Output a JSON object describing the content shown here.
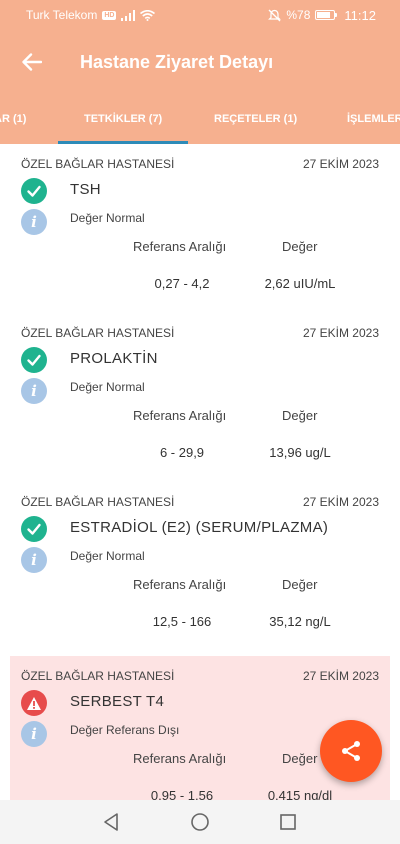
{
  "status_bar": {
    "carrier": "Turk Telekom",
    "carrier_badge": "HD",
    "battery": "%78",
    "battery_level": 0.78,
    "time": "11:12"
  },
  "app_bar": {
    "title": "Hastane Ziyaret Detayı",
    "back_icon": "arrow-left-icon"
  },
  "tabs": [
    {
      "label": "AR (1)",
      "selected": false
    },
    {
      "label": "TETKİKLER (7)",
      "selected": true
    },
    {
      "label": "REÇETELER (1)",
      "selected": false
    },
    {
      "label": "İŞLEMLER",
      "selected": false
    }
  ],
  "colors": {
    "primary": "#f6b08f",
    "tab_indicator": "#2d8bb8",
    "ok": "#1fb38f",
    "warn": "#e74c4c",
    "info": "#a8c6e6",
    "alert_bg": "#fde3e3",
    "fab": "#ff5722"
  },
  "labels": {
    "reference_range": "Referans Aralığı",
    "value": "Değer"
  },
  "tests": [
    {
      "hospital": "ÖZEL BAĞLAR HASTANESİ",
      "date": "27 EKİM 2023",
      "name": "TSH",
      "status": "Değer Normal",
      "status_icon": "check-icon",
      "reference_range": "0,27 - 4,2",
      "value": "2,62 uIU/mL"
    },
    {
      "hospital": "ÖZEL BAĞLAR HASTANESİ",
      "date": "27 EKİM 2023",
      "name": "PROLAKTİN",
      "status": "Değer Normal",
      "status_icon": "check-icon",
      "reference_range": "6 - 29,9",
      "value": "13,96 ug/L"
    },
    {
      "hospital": "ÖZEL BAĞLAR HASTANESİ",
      "date": "27 EKİM 2023",
      "name": "ESTRADİOL (E2) (SERUM/PLAZMA)",
      "status": "Değer Normal",
      "status_icon": "check-icon",
      "reference_range": "12,5 - 166",
      "value": "35,12 ng/L"
    },
    {
      "hospital": "ÖZEL BAĞLAR HASTANESİ",
      "date": "27 EKİM 2023",
      "name": "SERBEST T4",
      "status": "Değer Referans Dışı",
      "status_icon": "warning-icon",
      "reference_range": "0,95 - 1,56",
      "value": "0,415 ng/dl"
    }
  ],
  "fab": {
    "icon": "share-icon"
  },
  "nav_bar": {
    "icons": [
      "back-triangle-icon",
      "home-circle-icon",
      "recents-square-icon"
    ]
  }
}
